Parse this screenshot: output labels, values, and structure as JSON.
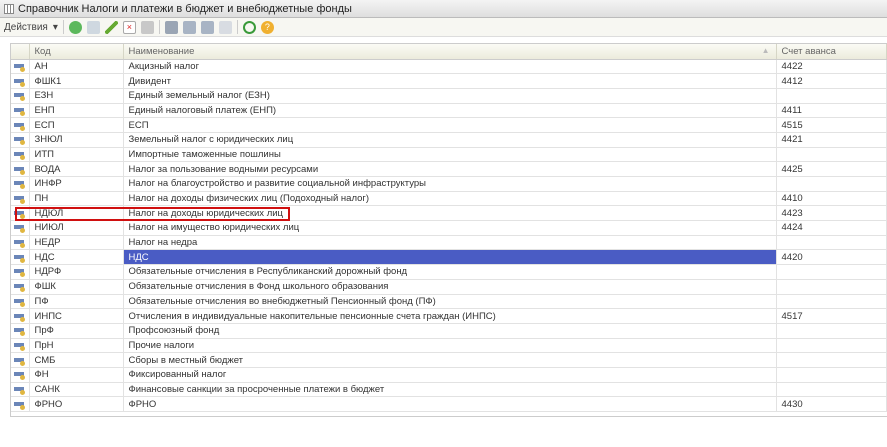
{
  "window": {
    "title": "Справочник Налоги и платежи в бюджет и внебюджетные фонды"
  },
  "toolbar": {
    "actions_label": "Действия"
  },
  "columns": {
    "code": "Код",
    "name": "Наименование",
    "account": "Счет аванса"
  },
  "rows": [
    {
      "code": "АН",
      "name": "Акцизный налог",
      "account": "4422"
    },
    {
      "code": "ФШК1",
      "name": "Дивидент",
      "account": "4412"
    },
    {
      "code": "ЕЗН",
      "name": "Единый земельный налог (ЕЗН)",
      "account": ""
    },
    {
      "code": "ЕНП",
      "name": "Единый налоговый платеж (ЕНП)",
      "account": "4411"
    },
    {
      "code": "ЕСП",
      "name": "ЕСП",
      "account": "4515"
    },
    {
      "code": "ЗНЮЛ",
      "name": "Земельный налог с юридических лиц",
      "account": "4421"
    },
    {
      "code": "ИТП",
      "name": "Импортные таможенные пошлины",
      "account": ""
    },
    {
      "code": "ВОДА",
      "name": "Налог за пользование водными ресурсами",
      "account": "4425"
    },
    {
      "code": "ИНФР",
      "name": "Налог на благоустройство и развитие социальной инфраструктуры",
      "account": ""
    },
    {
      "code": "ПН",
      "name": "Налог на доходы физических лиц (Подоходный налог)",
      "account": "4410"
    },
    {
      "code": "НДЮЛ",
      "name": "Налог на доходы юридических лиц",
      "account": "4423"
    },
    {
      "code": "НИЮЛ",
      "name": "Налог на имущество юридических лиц",
      "account": "4424"
    },
    {
      "code": "НЕДР",
      "name": "Налог на недра",
      "account": ""
    },
    {
      "code": "НДС",
      "name": "НДС",
      "account": "4420"
    },
    {
      "code": "НДРФ",
      "name": "Обязательные отчисления в Республиканский дорожный фонд",
      "account": ""
    },
    {
      "code": "ФШК",
      "name": "Обязательные отчисления в Фонд школьного образования",
      "account": ""
    },
    {
      "code": "ПФ",
      "name": "Обязательные отчисления во внебюджетный Пенсионный фонд (ПФ)",
      "account": ""
    },
    {
      "code": "ИНПС",
      "name": "Отчисления в индивидуальные накопительные пенсионные счета граждан (ИНПС)",
      "account": "4517"
    },
    {
      "code": "ПрФ",
      "name": "Профсоюзный фонд",
      "account": ""
    },
    {
      "code": "ПрН",
      "name": "Прочие налоги",
      "account": ""
    },
    {
      "code": "СМБ",
      "name": "Сборы в местный бюджет",
      "account": ""
    },
    {
      "code": "ФН",
      "name": "Фиксированный налог",
      "account": ""
    },
    {
      "code": "САНК",
      "name": "Финансовые санкции за просроченные платежи в бюджет",
      "account": ""
    },
    {
      "code": "ФРНО",
      "name": "ФРНО",
      "account": "4430"
    }
  ],
  "selected_code": "НДС"
}
